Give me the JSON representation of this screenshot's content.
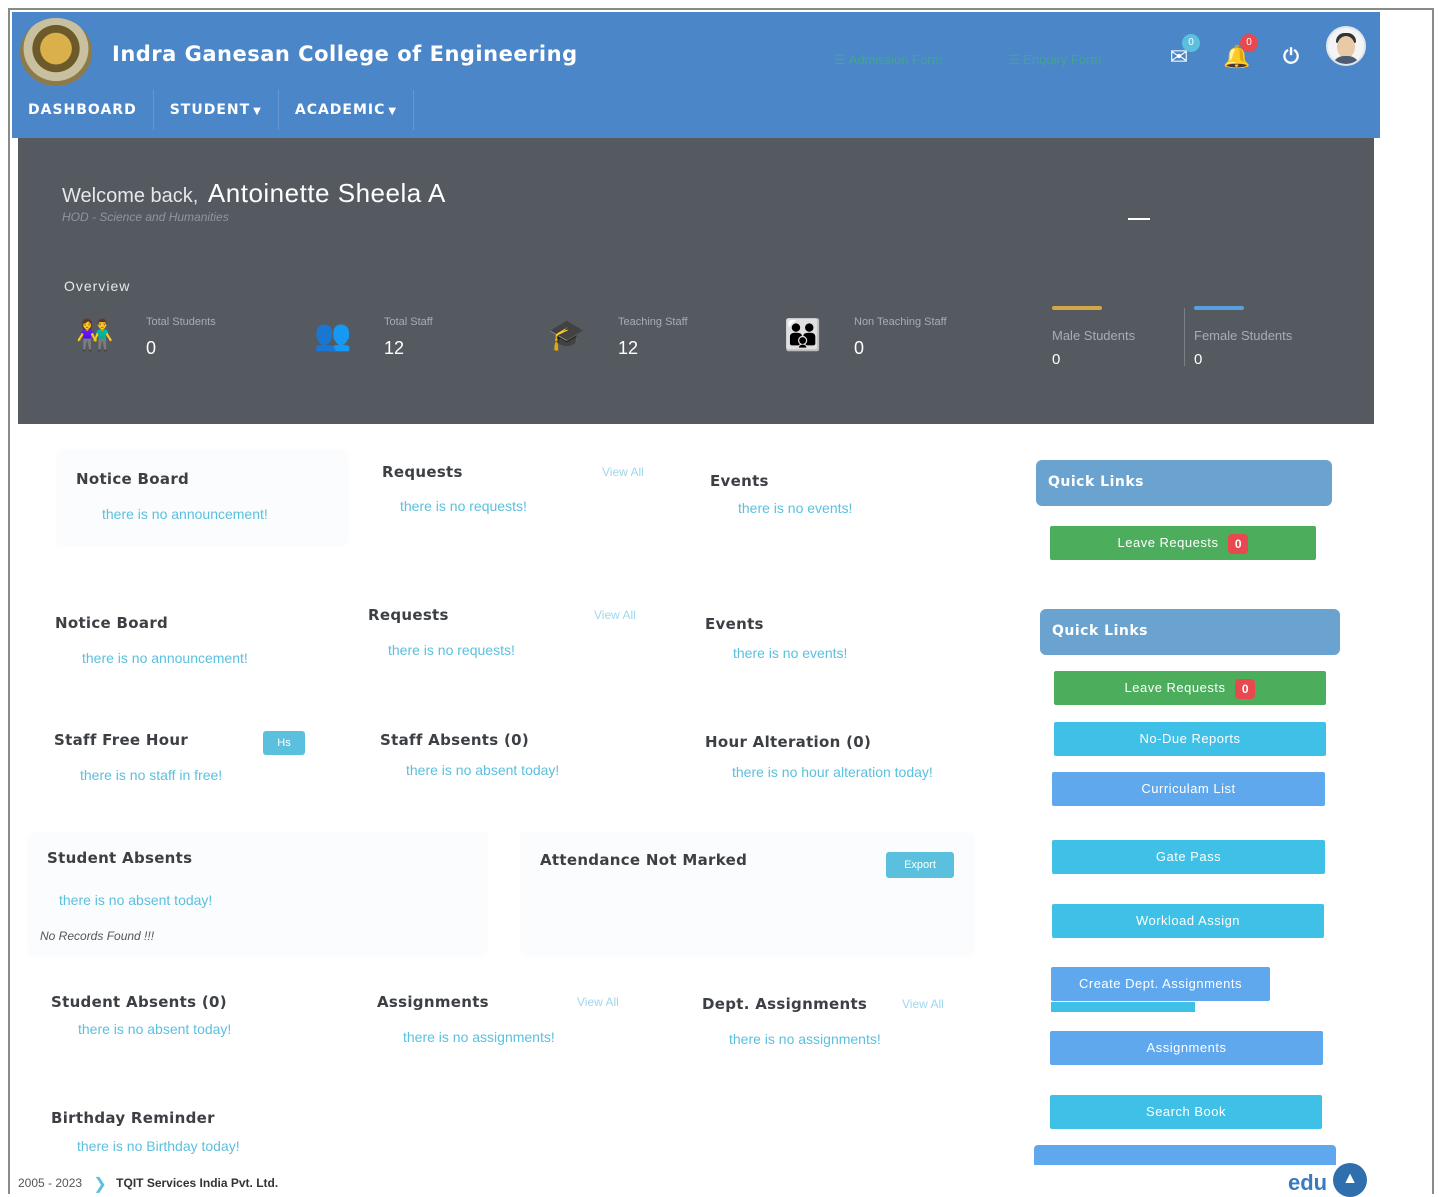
{
  "header": {
    "college_name": "Indra Ganesan College of Engineering",
    "admission_link": "☰ Admission Form",
    "enquiry_link": "☰ Enquiry Form",
    "message_count": "0",
    "notification_count": "0",
    "brand_color": "#4a86c8"
  },
  "nav": {
    "items": [
      "DASHBOARD",
      "STUDENT",
      "ACADEMIC"
    ]
  },
  "welcome": {
    "greeting": "Welcome back,",
    "name": "Antoinette Sheela A",
    "designation": "HOD - Science and Humanities",
    "overview_label": "Overview"
  },
  "stats": [
    {
      "label": "Total Students",
      "value": "0",
      "icon": "students-icon",
      "color": "#3fbf5f"
    },
    {
      "label": "Total Staff",
      "value": "12",
      "icon": "staff-group-icon",
      "color": "#5aa0e0"
    },
    {
      "label": "Teaching Staff",
      "value": "12",
      "icon": "graduation-cap-icon",
      "color": "#2f8a8a"
    },
    {
      "label": "Non Teaching Staff",
      "value": "0",
      "icon": "people-icon",
      "color": "#e0a030"
    }
  ],
  "gender_stats": [
    {
      "label": "Male Students",
      "value": "0",
      "color": "#d4a64a"
    },
    {
      "label": "Female Students",
      "value": "0",
      "color": "#5aa0e0"
    }
  ],
  "cards_top": {
    "notice_title": "Notice Board",
    "notice_empty": "there is no announcement!",
    "requests_title": "Requests",
    "requests_view_all": "View All",
    "requests_empty": "there is no requests!",
    "events_title": "Events",
    "events_empty": "there is no events!"
  },
  "cards_main": {
    "notice_title": "Notice Board",
    "notice_empty": "there is no announcement!",
    "requests_title": "Requests",
    "requests_view_all": "View All",
    "requests_empty": "there is no requests!",
    "events_title": "Events",
    "events_empty": "there is no events!",
    "staff_free_title": "Staff Free Hour",
    "staff_free_button": "Hs",
    "staff_free_empty": "there is no staff in free!",
    "staff_absents_title": "Staff Absents (0)",
    "staff_absents_empty": "there is no absent today!",
    "hour_alteration_title": "Hour Alteration (0)",
    "hour_alteration_empty": "there is no hour alteration today!",
    "student_absents_title": "Student Absents",
    "student_absents_empty": "there is no absent today!",
    "no_records": "No Records Found !!!",
    "attendance_title": "Attendance Not Marked",
    "attendance_export": "Export",
    "student_absents0_title": "Student Absents (0)",
    "student_absents0_empty": "there is no absent today!",
    "assignments_title": "Assignments",
    "assignments_view_all": "View All",
    "assignments_empty": "there is no assignments!",
    "dept_assignments_title": "Dept. Assignments",
    "dept_assignments_view_all": "View All",
    "dept_assignments_empty": "there is no assignments!",
    "birthday_title": "Birthday Reminder",
    "birthday_empty": "there is no Birthday today!"
  },
  "quick_links_top": {
    "title": "Quick Links",
    "leave_requests": "Leave Requests",
    "leave_count": "0"
  },
  "quick_links": {
    "title": "Quick Links",
    "leave_requests": "Leave Requests",
    "leave_count": "0",
    "no_due_reports": "No-Due Reports",
    "curriculam_list": "Curriculam List",
    "gate_pass": "Gate Pass",
    "workload_assign": "Workload Assign",
    "create_dept_assignments": "Create Dept. Assignments",
    "assignments": "Assignments",
    "search_book": "Search Book"
  },
  "footer": {
    "years": "2005 - 2023",
    "company": "TQIT Services India Pvt. Ltd.",
    "edu": "edu"
  }
}
